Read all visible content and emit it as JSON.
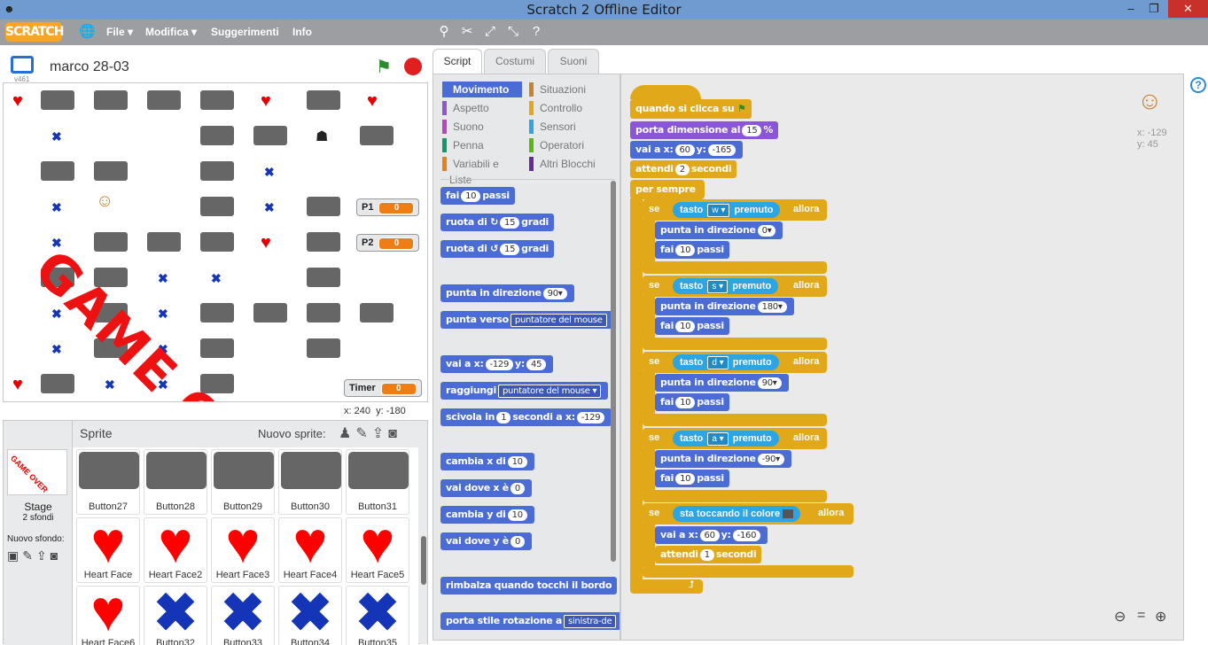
{
  "window": {
    "title": "Scratch 2 Offline Editor",
    "controls": [
      "–",
      "❐",
      "✕"
    ]
  },
  "menu": {
    "logo": "SCRATCH",
    "items": [
      "File",
      "Modifica",
      "Suggerimenti",
      "Info"
    ],
    "file_arrow": "▾"
  },
  "project": {
    "name": "marco 28-03",
    "version": "v461"
  },
  "stage": {
    "gameover": "GAME OVER",
    "monitors": [
      {
        "label": "P1",
        "value": "0"
      },
      {
        "label": "P2",
        "value": "0"
      },
      {
        "label": "Timer",
        "value": "0"
      }
    ],
    "coords": {
      "x_label": "x:",
      "x": "240",
      "y_label": "y:",
      "y": "-180"
    }
  },
  "sprites": {
    "header": "Sprite",
    "new_sprite": "Nuovo sprite:",
    "stage_label": "Stage",
    "stage_sub": "2 sfondi",
    "new_backdrop": "Nuovo sfondo:",
    "items": [
      {
        "name": "Button27",
        "kind": "button"
      },
      {
        "name": "Button28",
        "kind": "button"
      },
      {
        "name": "Button29",
        "kind": "button"
      },
      {
        "name": "Button30",
        "kind": "button"
      },
      {
        "name": "Button31",
        "kind": "button"
      },
      {
        "name": "Heart Face",
        "kind": "heart"
      },
      {
        "name": "Heart Face2",
        "kind": "heart"
      },
      {
        "name": "Heart Face3",
        "kind": "heart"
      },
      {
        "name": "Heart Face4",
        "kind": "heart"
      },
      {
        "name": "Heart Face5",
        "kind": "heart"
      },
      {
        "name": "Heart Face6",
        "kind": "heart"
      },
      {
        "name": "Button32",
        "kind": "x"
      },
      {
        "name": "Button33",
        "kind": "x"
      },
      {
        "name": "Button34",
        "kind": "x"
      },
      {
        "name": "Button35",
        "kind": "x"
      }
    ]
  },
  "tabs": [
    "Script",
    "Costumi",
    "Suoni"
  ],
  "categories": [
    {
      "label": "Movimento",
      "color": "#4a6cd4",
      "selected": true
    },
    {
      "label": "Situazioni",
      "color": "#c88330"
    },
    {
      "label": "Aspetto",
      "color": "#8a55d7"
    },
    {
      "label": "Controllo",
      "color": "#e1a91a"
    },
    {
      "label": "Suono",
      "color": "#bb42c3"
    },
    {
      "label": "Sensori",
      "color": "#2ca5e2"
    },
    {
      "label": "Penna",
      "color": "#0e9a6c"
    },
    {
      "label": "Operatori",
      "color": "#5cb712"
    },
    {
      "label": "Variabili e Liste",
      "color": "#ee7d16"
    },
    {
      "label": "Altri Blocchi",
      "color": "#632d99"
    }
  ],
  "palette": {
    "fai": "fai",
    "passi": "passi",
    "v10": "10",
    "ruota_di": "ruota di",
    "gradi": "gradi",
    "v15": "15",
    "punta_in_direzione": "punta in direzione",
    "v90": "90",
    "punta_verso": "punta verso",
    "puntatore": "puntatore del mouse",
    "vai_a_x": "vai a x:",
    "y": "y:",
    "vx": "-129",
    "vy": "45",
    "raggiungi": "raggiungi",
    "scivola_in": "scivola in",
    "v1": "1",
    "secondi_a_x": "secondi a x:",
    "cambia_x_di": "cambia x di",
    "vai_dove_x": "vai dove x è",
    "v0": "0",
    "cambia_y_di": "cambia y di",
    "vai_dove_y": "vai dove y è",
    "rimbalza": "rimbalza quando tocchi il bordo",
    "porta_stile": "porta stile rotazione a",
    "sinistra": "sinistra-de"
  },
  "script": {
    "hat": "quando si clicca su",
    "porta_dimensione": "porta dimensione al",
    "dim_val": "15",
    "percent": "%",
    "vai_a_x": "vai a x:",
    "x1": "60",
    "y_label": "y:",
    "y1": "-165",
    "attendi": "attendi",
    "att_val": "2",
    "secondi": "secondi",
    "per_sempre": "per sempre",
    "se": "se",
    "tasto": "tasto",
    "premuto": "premuto",
    "allora": "allora",
    "punta_in_direzione": "punta in direzione",
    "fai": "fai",
    "passi": "passi",
    "step": "10",
    "keys": [
      "w",
      "s",
      "d",
      "a"
    ],
    "dirs": [
      "0",
      "180",
      "90",
      "-90"
    ],
    "sta_toccando": "sta toccando il colore",
    "x2": "60",
    "y2": "-160",
    "att2": "1"
  },
  "sprite_info": {
    "x_label": "x:",
    "x": "-129",
    "y_label": "y:",
    "y": "45"
  }
}
